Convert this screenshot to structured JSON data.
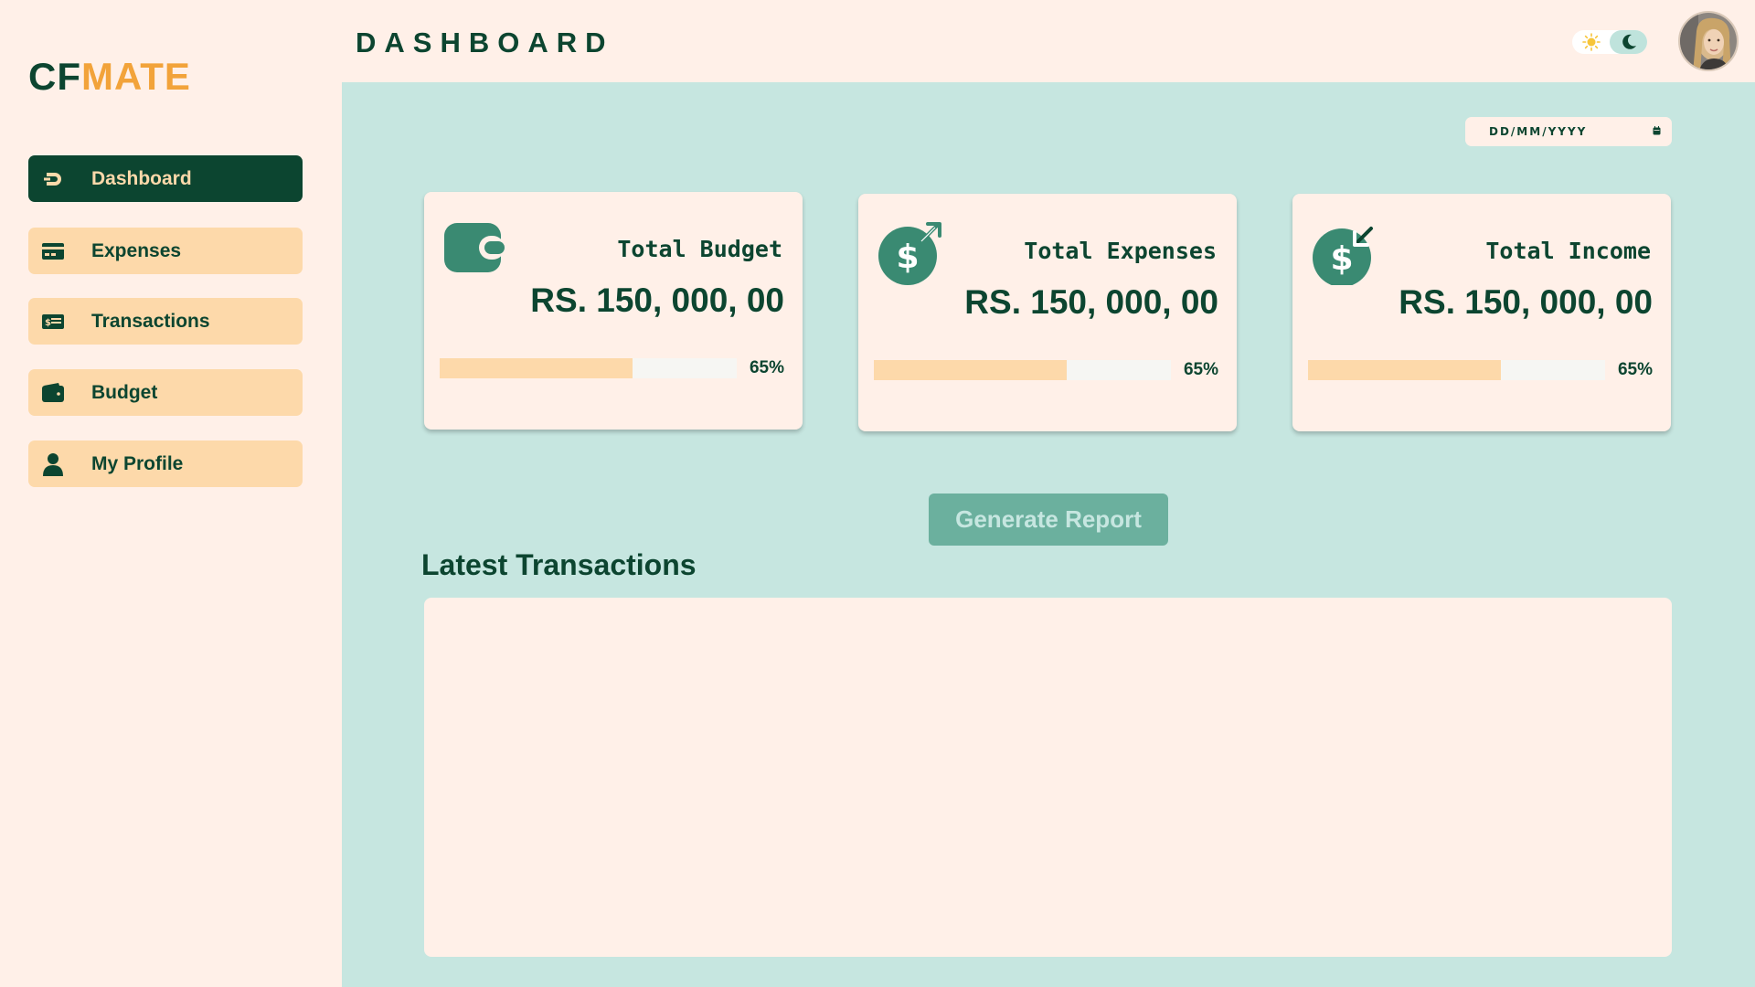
{
  "app": {
    "logo_prefix": "CF",
    "logo_suffix": "MATE"
  },
  "sidebar": {
    "items": [
      {
        "label": "Dashboard",
        "icon": "dashboard-icon",
        "active": true
      },
      {
        "label": "Expenses",
        "icon": "credit-card-icon",
        "active": false
      },
      {
        "label": "Transactions",
        "icon": "money-bill-icon",
        "active": false
      },
      {
        "label": "Budget",
        "icon": "wallet-icon",
        "active": false
      },
      {
        "label": "My Profile",
        "icon": "user-icon",
        "active": false
      }
    ]
  },
  "header": {
    "title": "DASHBOARD",
    "theme_light_icon": "sun-icon",
    "theme_dark_icon": "moon-icon"
  },
  "date_filter": {
    "placeholder": "DD/MM/YYYY",
    "icon": "calendar-icon"
  },
  "cards": [
    {
      "title": "Total Budget",
      "amount": "RS. 150, 000, 00",
      "progress_percent": 65,
      "progress_label": "65%",
      "icon": "wallet-icon"
    },
    {
      "title": "Total Expenses",
      "amount": "RS. 150, 000, 00",
      "progress_percent": 65,
      "progress_label": "65%",
      "icon": "dollar-outgoing-icon"
    },
    {
      "title": "Total Income",
      "amount": "RS. 150, 000, 00",
      "progress_percent": 65,
      "progress_label": "65%",
      "icon": "dollar-incoming-icon"
    }
  ],
  "actions": {
    "generate_report_label": "Generate Report"
  },
  "transactions": {
    "title": "Latest Transactions",
    "rows": []
  },
  "colors": {
    "primary_dark": "#0c4530",
    "accent_orange": "#f2a33a",
    "sidebar_item_bg": "#fdd9aa",
    "main_bg": "#c6e6e0",
    "card_bg": "#fff0e8",
    "icon_teal": "#3a8a72",
    "button_bg": "#6bb09e"
  }
}
